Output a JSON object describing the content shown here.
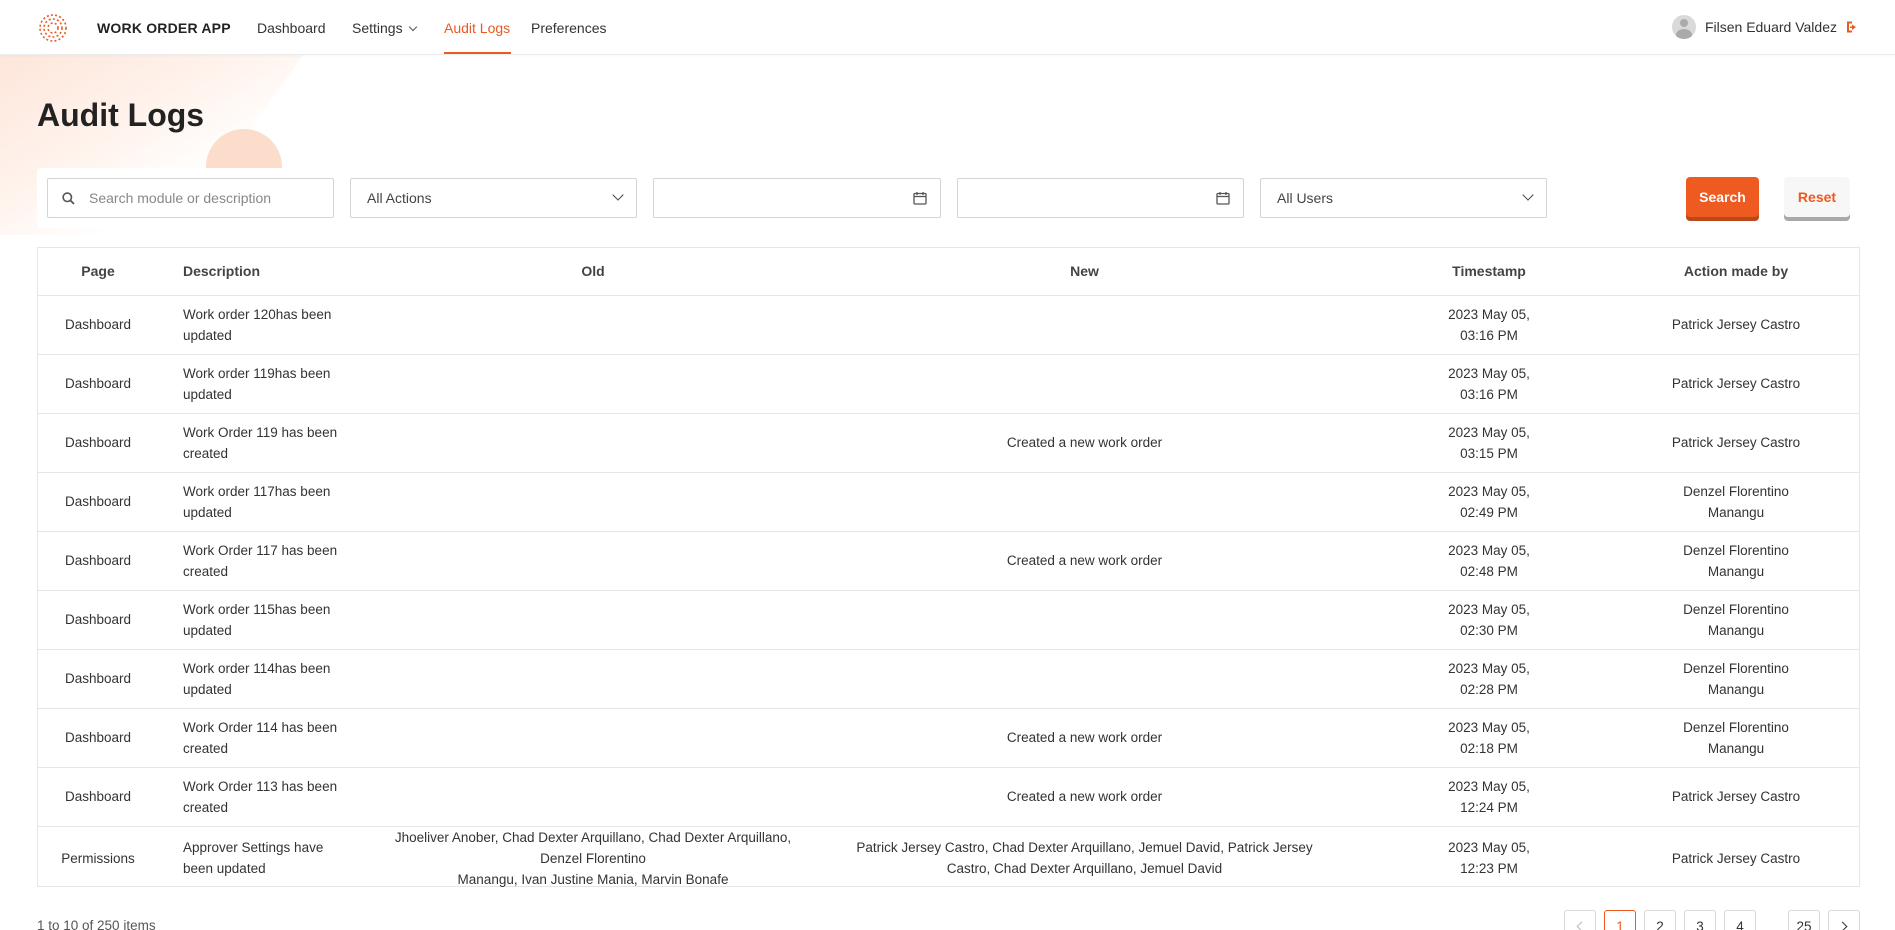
{
  "app": {
    "brand": "WORK ORDER APP",
    "accent_color": "#ea5a21"
  },
  "nav": {
    "dashboard": "Dashboard",
    "settings": "Settings",
    "audit_logs": "Audit Logs",
    "preferences": "Preferences",
    "active": "Audit Logs"
  },
  "user": {
    "name": "Filsen Eduard Valdez"
  },
  "page": {
    "title": "Audit Logs"
  },
  "filters": {
    "search_placeholder": "Search module or description",
    "actions_value": "All Actions",
    "start_date": "",
    "end_date": "",
    "users_value": "All Users",
    "search_label": "Search",
    "reset_label": "Reset"
  },
  "table": {
    "columns": [
      "Page",
      "Description",
      "Old",
      "New",
      "Timestamp",
      "Action made by"
    ],
    "rows": [
      {
        "page": "Dashboard",
        "description": [
          "Work order 120has been",
          "updated"
        ],
        "old": [],
        "new": [],
        "timestamp": [
          "2023 May 05,",
          "03:16 PM"
        ],
        "by": [
          "Patrick Jersey Castro"
        ]
      },
      {
        "page": "Dashboard",
        "description": [
          "Work order 119has been",
          "updated"
        ],
        "old": [],
        "new": [],
        "timestamp": [
          "2023 May 05,",
          "03:16 PM"
        ],
        "by": [
          "Patrick Jersey Castro"
        ]
      },
      {
        "page": "Dashboard",
        "description": [
          "Work Order 119 has been",
          "created"
        ],
        "old": [],
        "new": [
          "Created a new work order"
        ],
        "timestamp": [
          "2023 May 05,",
          "03:15 PM"
        ],
        "by": [
          "Patrick Jersey Castro"
        ]
      },
      {
        "page": "Dashboard",
        "description": [
          "Work order 117has been",
          "updated"
        ],
        "old": [],
        "new": [],
        "timestamp": [
          "2023 May 05,",
          "02:49 PM"
        ],
        "by": [
          "Denzel Florentino",
          "Manangu"
        ]
      },
      {
        "page": "Dashboard",
        "description": [
          "Work Order 117 has been",
          "created"
        ],
        "old": [],
        "new": [
          "Created a new work order"
        ],
        "timestamp": [
          "2023 May 05,",
          "02:48 PM"
        ],
        "by": [
          "Denzel Florentino",
          "Manangu"
        ]
      },
      {
        "page": "Dashboard",
        "description": [
          "Work order 115has been",
          "updated"
        ],
        "old": [],
        "new": [],
        "timestamp": [
          "2023 May 05,",
          "02:30 PM"
        ],
        "by": [
          "Denzel Florentino",
          "Manangu"
        ]
      },
      {
        "page": "Dashboard",
        "description": [
          "Work order 114has been",
          "updated"
        ],
        "old": [],
        "new": [],
        "timestamp": [
          "2023 May 05,",
          "02:28 PM"
        ],
        "by": [
          "Denzel Florentino",
          "Manangu"
        ]
      },
      {
        "page": "Dashboard",
        "description": [
          "Work Order 114 has been",
          "created"
        ],
        "old": [],
        "new": [
          "Created a new work order"
        ],
        "timestamp": [
          "2023 May 05,",
          "02:18 PM"
        ],
        "by": [
          "Denzel Florentino",
          "Manangu"
        ]
      },
      {
        "page": "Dashboard",
        "description": [
          "Work Order 113 has been",
          "created"
        ],
        "old": [],
        "new": [
          "Created a new work order"
        ],
        "timestamp": [
          "2023 May 05,",
          "12:24 PM"
        ],
        "by": [
          "Patrick Jersey Castro"
        ]
      },
      {
        "page": "Permissions",
        "description": [
          "Approver Settings have",
          "been updated"
        ],
        "old": [
          "Jhoeliver Anober, Chad Dexter Arquillano, Chad Dexter Arquillano, Denzel Florentino",
          "Manangu, Ivan Justine Mania, Marvin Bonafe"
        ],
        "new": [
          "Patrick Jersey Castro, Chad Dexter Arquillano, Jemuel David, Patrick Jersey",
          "Castro, Chad Dexter Arquillano, Jemuel David"
        ],
        "timestamp": [
          "2023 May 05,",
          "12:23 PM"
        ],
        "by": [
          "Patrick Jersey Castro"
        ]
      }
    ]
  },
  "pagination": {
    "summary": "1 to 10 of 250 items",
    "pages": [
      "1",
      "2",
      "3",
      "4"
    ],
    "last": "25",
    "current": "1"
  }
}
